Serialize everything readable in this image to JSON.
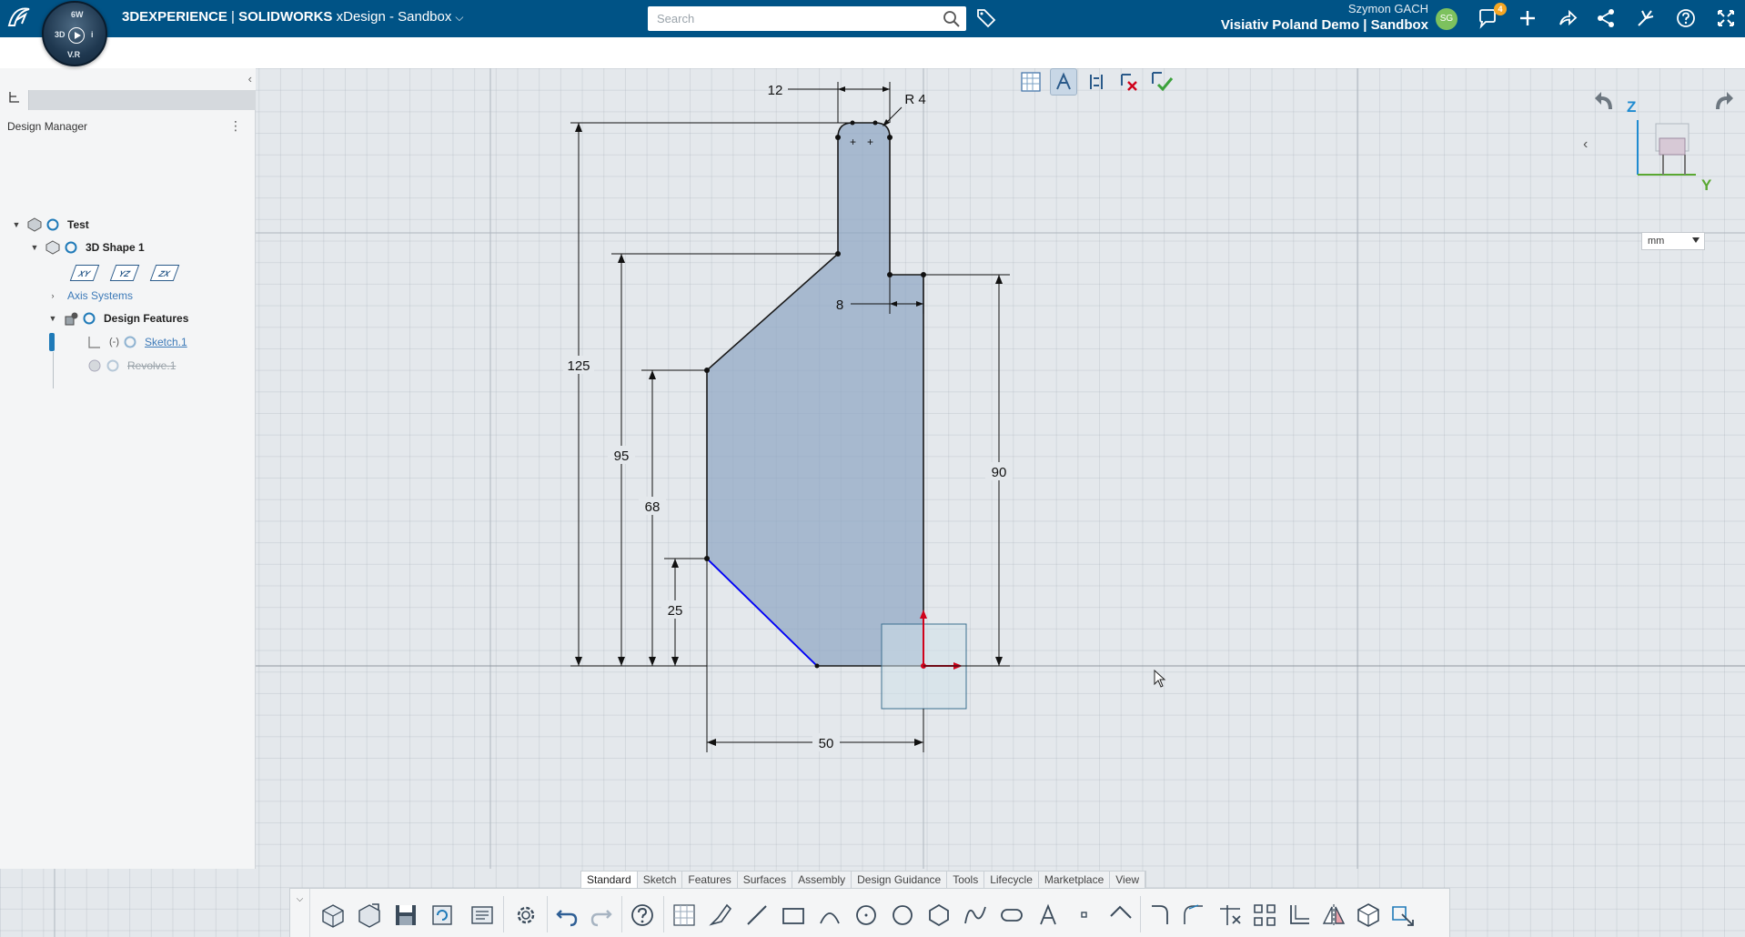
{
  "topbar": {
    "brand_prefix": "3DEXPERIENCE",
    "separator": " | ",
    "brand_app": "SOLIDWORKS",
    "app_name": " xDesign - Sandbox",
    "search_placeholder": "Search",
    "user_name": "Szymon GACH",
    "tenant": "Visiativ Poland Demo | Sandbox",
    "avatar_initials": "SG",
    "notification_count": "4",
    "compass_label": "V.R",
    "compass_quadrants": [
      "3D",
      "6W",
      "i",
      "V.R"
    ],
    "icons": [
      "ds-logo-icon",
      "compass-icon",
      "search-icon",
      "tag-icon",
      "notifications-icon",
      "add-icon",
      "share-icon",
      "network-icon",
      "tools-icon",
      "help-icon",
      "fullscreen-icon"
    ],
    "colors": {
      "bar": "#005386",
      "avatar": "#7dc15e",
      "badge": "#f5a623"
    }
  },
  "left_panel": {
    "title": "Design Manager",
    "tree": [
      {
        "label": "Test",
        "level": 0,
        "expanded": true,
        "icon": "product-icon"
      },
      {
        "label": "3D Shape 1",
        "level": 1,
        "expanded": true,
        "icon": "shape-icon"
      },
      {
        "label": "Axis Systems",
        "level": 2,
        "expanded": false
      },
      {
        "label": "Design Features",
        "level": 2,
        "expanded": true,
        "icon": "features-icon"
      },
      {
        "label": "Sketch.1",
        "level": 3,
        "state": "(-)"
      },
      {
        "label": "Revolve.1",
        "level": 3,
        "state": "suppressed"
      }
    ],
    "planes": [
      "XY",
      "YZ",
      "ZX"
    ]
  },
  "sketch": {
    "dimensions": {
      "top_width": "12",
      "radius": "R 4",
      "overall_height": "125",
      "shoulder_height": "95",
      "mid_height": "68",
      "chamfer_height": "25",
      "neck_width": "8",
      "right_height": "90",
      "base_width": "50"
    },
    "fill_color": "#8fa6c4",
    "highlight_color": "#0000ff"
  },
  "view": {
    "units": "mm",
    "axis_z": "Z",
    "axis_y": "Y"
  },
  "tabs": [
    "Standard",
    "Sketch",
    "Features",
    "Surfaces",
    "Assembly",
    "Design Guidance",
    "Tools",
    "Lifecycle",
    "Marketplace",
    "View"
  ],
  "active_tab": "Standard"
}
